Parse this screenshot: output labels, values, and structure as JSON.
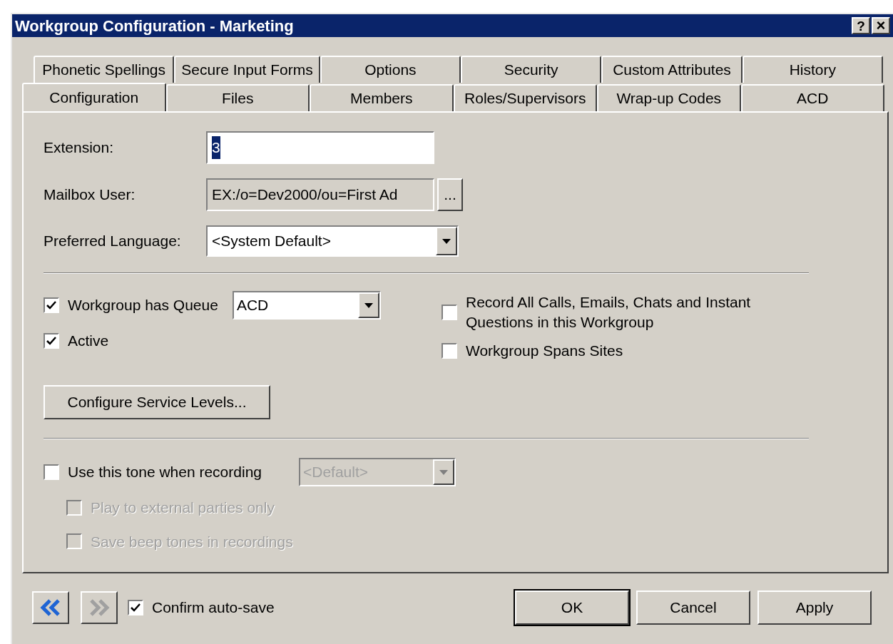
{
  "window": {
    "title": "Workgroup Configuration - Marketing",
    "help_button": "?",
    "close_button": "×"
  },
  "tab_rows": [
    [
      {
        "label": "Phonetic Spellings",
        "selected": false
      },
      {
        "label": "Secure Input Forms",
        "selected": false
      },
      {
        "label": "Options",
        "selected": false
      },
      {
        "label": "Security",
        "selected": false
      },
      {
        "label": "Custom Attributes",
        "selected": false
      },
      {
        "label": "History",
        "selected": false
      }
    ],
    [
      {
        "label": "Configuration",
        "selected": true
      },
      {
        "label": "Files",
        "selected": false
      },
      {
        "label": "Members",
        "selected": false
      },
      {
        "label": "Roles/Supervisors",
        "selected": false
      },
      {
        "label": "Wrap-up Codes",
        "selected": false
      },
      {
        "label": "ACD",
        "selected": false
      }
    ]
  ],
  "fields": [
    {
      "kind": "text",
      "label": "Extension:",
      "value": "3"
    },
    {
      "kind": "browse",
      "label": "Mailbox User:",
      "value": "EX:/o=Dev2000/ou=First Ad",
      "button": "..."
    },
    {
      "kind": "dropdown",
      "label": "Preferred Language:",
      "value": "<System Default>"
    }
  ],
  "options_left": [
    {
      "label": "Workgroup has Queue",
      "checked": true,
      "dropdown": "ACD"
    },
    {
      "label": "Active",
      "checked": true
    }
  ],
  "options_right": [
    {
      "label": "Record All Calls, Emails, Chats and Instant Questions in this Workgroup",
      "checked": false
    },
    {
      "label": "Workgroup Spans Sites",
      "checked": false
    }
  ],
  "service_levels_button": "Configure Service Levels...",
  "recording": {
    "label": "Use this tone when recording",
    "checked": false,
    "dropdown": "<Default>",
    "dropdown_disabled": true,
    "sub_options": [
      {
        "label": "Play to external parties only",
        "checked": false,
        "disabled": true
      },
      {
        "label": "Save beep tones in recordings",
        "checked": false,
        "disabled": true
      }
    ]
  },
  "footer": {
    "back_disabled": false,
    "forward_disabled": true,
    "confirm": {
      "label": "Confirm auto-save",
      "checked": true
    },
    "buttons": [
      {
        "label": "OK",
        "default": true
      },
      {
        "label": "Cancel",
        "default": false
      },
      {
        "label": "Apply",
        "default": false
      }
    ]
  }
}
